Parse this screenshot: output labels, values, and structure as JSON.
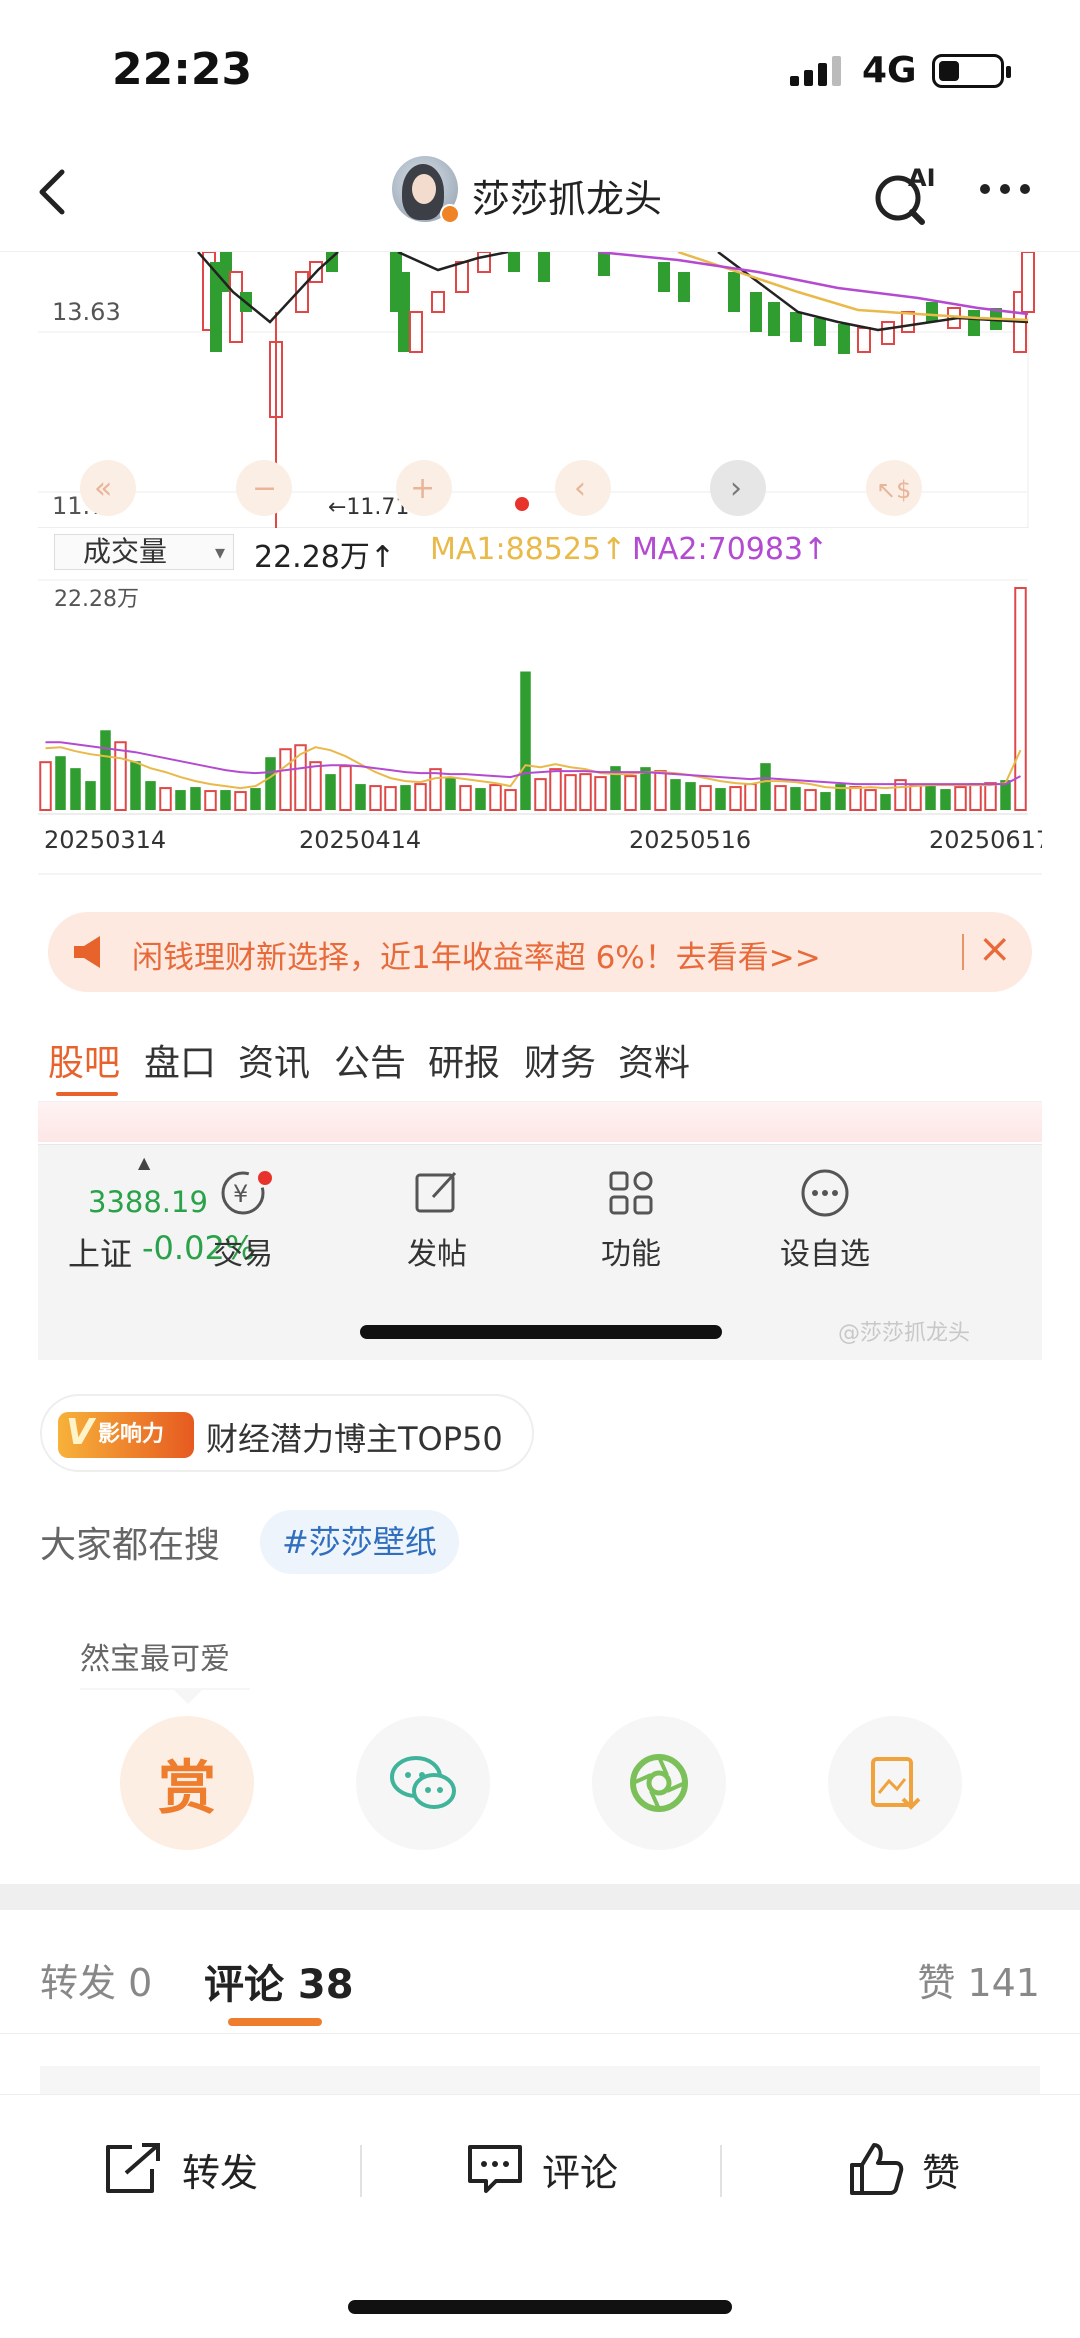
{
  "status_bar": {
    "time": "22:23",
    "network": "4G"
  },
  "header": {
    "title": "莎莎抓龙头",
    "ai_label": "AI"
  },
  "shared_image": {
    "chart_data": [
      {
        "type": "candlestick",
        "ytick_labels": [
          "13.63",
          "11.71"
        ],
        "annotations": [
          "←11.71"
        ],
        "controls": [
          "«",
          "−",
          "+",
          "‹",
          "›",
          "↖$"
        ]
      },
      {
        "type": "bar",
        "selector": "成交量",
        "volume_label": "22.28万↑",
        "ma1_label": "MA1:88525↑",
        "ma2_label": "MA2:70983↑",
        "y_max_label": "22.28万",
        "x_tick_labels": [
          "20250314",
          "20250414",
          "20250516",
          "20250617"
        ],
        "values_wan": [
          4.8,
          5.4,
          4.2,
          2.9,
          8.0,
          6.8,
          4.9,
          2.9,
          2.2,
          2.0,
          2.3,
          1.9,
          2.0,
          1.8,
          2.2,
          5.3,
          6.1,
          6.5,
          4.8,
          3.6,
          4.4,
          2.6,
          2.4,
          2.3,
          2.5,
          2.6,
          4.1,
          3.2,
          2.4,
          2.2,
          2.5,
          2.0,
          13.9,
          3.1,
          4.1,
          3.5,
          3.6,
          3.3,
          4.4,
          3.4,
          4.3,
          3.9,
          3.1,
          2.8,
          2.4,
          2.2,
          2.3,
          2.6,
          4.7,
          2.4,
          2.3,
          2.0,
          1.8,
          2.6,
          2.3,
          2.0,
          1.6,
          3.0,
          2.5,
          2.6,
          2.1,
          2.3,
          2.6,
          2.7,
          3.0,
          22.28
        ],
        "up_flags": [
          1,
          0,
          0,
          0,
          0,
          1,
          0,
          0,
          1,
          0,
          0,
          1,
          0,
          1,
          0,
          0,
          1,
          1,
          1,
          0,
          1,
          0,
          1,
          1,
          0,
          1,
          1,
          0,
          1,
          0,
          1,
          1,
          0,
          1,
          1,
          1,
          1,
          1,
          0,
          1,
          0,
          1,
          0,
          0,
          1,
          0,
          1,
          1,
          0,
          1,
          0,
          1,
          0,
          0,
          1,
          1,
          0,
          1,
          1,
          0,
          0,
          1,
          1,
          1,
          0,
          1
        ],
        "ma1_series": [
          6.2,
          6.3,
          5.9,
          5.6,
          5.4,
          5.2,
          4.8,
          4.2,
          3.8,
          3.3,
          2.9,
          2.6,
          2.4,
          2.2,
          2.4,
          3.3,
          4.4,
          5.6,
          6.3,
          6.0,
          5.4,
          4.6,
          3.8,
          3.2,
          2.9,
          2.8,
          3.2,
          3.3,
          3.1,
          2.9,
          2.7,
          2.4,
          4.5,
          4.3,
          4.6,
          4.3,
          4.1,
          3.7,
          3.6,
          3.6,
          3.8,
          3.8,
          3.7,
          3.5,
          3.2,
          2.9,
          2.7,
          2.6,
          2.9,
          2.9,
          2.8,
          2.6,
          2.3,
          2.2,
          2.2,
          2.3,
          2.2,
          2.3,
          2.4,
          2.5,
          2.5,
          2.5,
          2.5,
          2.5,
          2.7,
          6.0
        ],
        "ma2_series": [
          6.8,
          6.8,
          6.6,
          6.4,
          6.2,
          6.0,
          5.8,
          5.5,
          5.2,
          4.9,
          4.6,
          4.3,
          4.0,
          3.8,
          3.7,
          3.8,
          4.0,
          4.2,
          4.4,
          4.5,
          4.5,
          4.4,
          4.2,
          4.0,
          3.8,
          3.7,
          3.7,
          3.6,
          3.6,
          3.5,
          3.4,
          3.3,
          3.7,
          3.8,
          3.9,
          3.9,
          3.9,
          3.8,
          3.8,
          3.8,
          3.8,
          3.7,
          3.6,
          3.5,
          3.4,
          3.3,
          3.2,
          3.1,
          3.2,
          3.1,
          3.0,
          2.9,
          2.8,
          2.7,
          2.6,
          2.6,
          2.6,
          2.6,
          2.6,
          2.6,
          2.6,
          2.6,
          2.6,
          2.6,
          2.6,
          3.4
        ]
      }
    ],
    "promo": {
      "text": "闲钱理财新选择，近1年收益率超 6%！去看看>>",
      "close": "×"
    },
    "tabs": [
      "股吧",
      "盘口",
      "资讯",
      "公告",
      "研报",
      "财务",
      "资料"
    ],
    "index": {
      "value": "3388.19",
      "name": "上证",
      "change": "-0.02%"
    },
    "toolbar": [
      "交易",
      "发帖",
      "功能",
      "设自选"
    ],
    "watermark": "@莎莎抓龙头"
  },
  "badge": {
    "logo_text": "影响力",
    "text": "财经潜力博主TOP50"
  },
  "search": {
    "label": "大家都在搜",
    "tag": "#莎莎壁纸"
  },
  "tip": {
    "text": "然宝最可爱"
  },
  "actions": {
    "reward_label": "赏"
  },
  "comment_tabs": {
    "forward": "转发 0",
    "comments": "评论 38",
    "likes": "赞 141"
  },
  "action_bar": {
    "forward": "转发",
    "comment": "评论",
    "like": "赞"
  },
  "colors": {
    "accent": "#ef7d2e",
    "up": "#e04848",
    "down": "#2f9d2f",
    "ma1": "#e9b94a",
    "ma2": "#b44ad1"
  }
}
